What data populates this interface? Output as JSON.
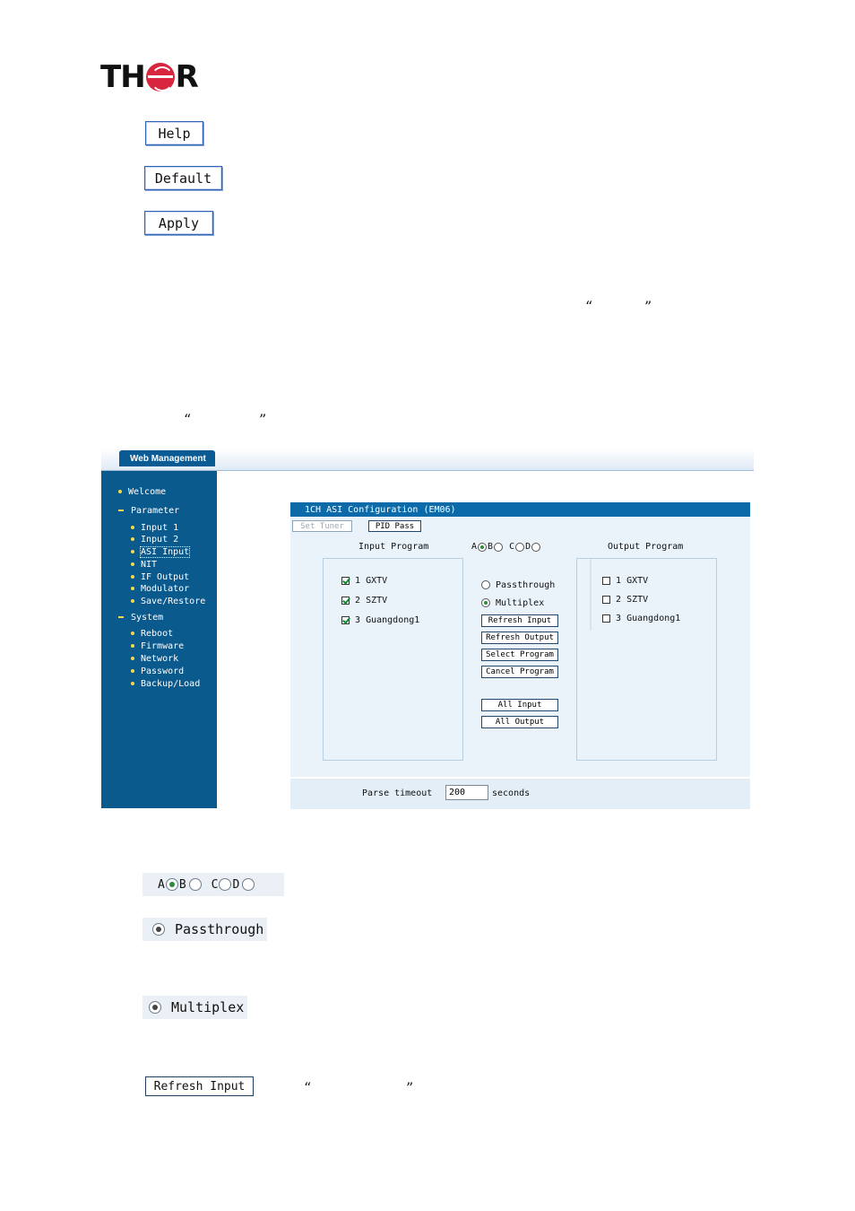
{
  "logo": {
    "left": "TH",
    "right": "R"
  },
  "buttons": {
    "help": "Help",
    "default": "Default",
    "apply": "Apply"
  },
  "quotes": {
    "open": "“",
    "close": "”"
  },
  "webui": {
    "tab_label": "Web Management",
    "nav": {
      "welcome": "Welcome",
      "parameter": "Parameter",
      "parameter_items": [
        "Input 1",
        "Input 2",
        "ASI Input",
        "NIT",
        "IF Output",
        "Modulator",
        "Save/Restore"
      ],
      "system": "System",
      "system_items": [
        "Reboot",
        "Firmware",
        "Network",
        "Password",
        "Backup/Load"
      ]
    },
    "panel_title": "1CH ASI Configuration (EM06)",
    "set_tuner": "Set Tuner",
    "pid_pass": "PID Pass",
    "input_program_header": "Input Program",
    "output_program_header": "Output Program",
    "abcd": [
      "A",
      "B",
      "C",
      "D"
    ],
    "input_programs": [
      {
        "label": "1 GXTV",
        "checked": true
      },
      {
        "label": "2 SZTV",
        "checked": true
      },
      {
        "label": "3 Guangdong1",
        "checked": true
      }
    ],
    "output_programs": [
      {
        "label": "1 GXTV",
        "checked": false
      },
      {
        "label": "2 SZTV",
        "checked": false
      },
      {
        "label": "3 Guangdong1",
        "checked": false
      }
    ],
    "mode_passthrough": "Passthrough",
    "mode_multiplex": "Multiplex",
    "actions": {
      "refresh_input": "Refresh Input",
      "refresh_output": "Refresh Output",
      "select_program": "Select Program",
      "cancel_program": "Cancel Program",
      "all_input": "All Input",
      "all_output": "All Output"
    },
    "parse_timeout_label": "Parse timeout",
    "parse_timeout_value": "200",
    "parse_timeout_unit": "seconds"
  },
  "zoomed": {
    "abcd": [
      "A",
      "B",
      "C",
      "D"
    ],
    "passthrough": "Passthrough",
    "multiplex": "Multiplex",
    "refresh_input": "Refresh Input"
  }
}
